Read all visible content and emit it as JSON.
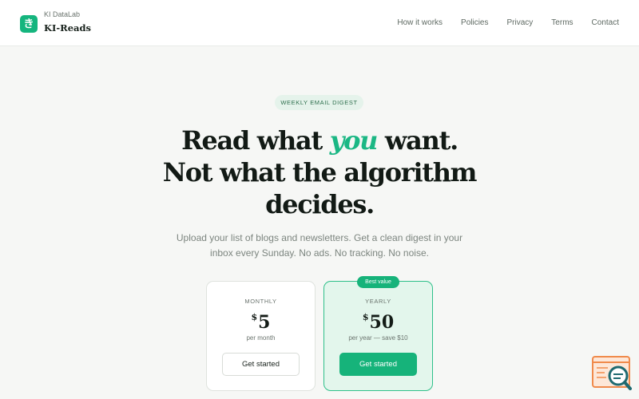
{
  "header": {
    "logo_glyph": "き",
    "org_name": "KI DataLab",
    "brand_name": "KI-Reads",
    "nav": [
      {
        "label": "How it works"
      },
      {
        "label": "Policies"
      },
      {
        "label": "Privacy"
      },
      {
        "label": "Terms"
      },
      {
        "label": "Contact"
      }
    ]
  },
  "hero": {
    "badge": "WEEKLY EMAIL DIGEST",
    "headline_1": "Read what ",
    "headline_accent": "you",
    "headline_2": " want.",
    "headline_line2": "Not what the algorithm",
    "headline_line3": "decides.",
    "subtitle": "Upload your list of blogs and newsletters. Get a clean digest in your inbox every Sunday. No ads. No tracking. No noise."
  },
  "pricing": {
    "monthly": {
      "label": "MONTHLY",
      "currency": "$",
      "amount": "5",
      "note": "per month",
      "cta": "Get started"
    },
    "yearly": {
      "badge": "Best value",
      "label": "YEARLY",
      "currency": "$",
      "amount": "50",
      "note": "per year — save $10",
      "cta": "Get started"
    }
  },
  "widget": {
    "icon": "chat-search-icon"
  },
  "colors": {
    "accent": "#16b37a",
    "background": "#f6f7f5",
    "card_highlight": "#e3f6ec",
    "widget_orange": "#f08a4b",
    "widget_teal": "#1f6a70"
  }
}
